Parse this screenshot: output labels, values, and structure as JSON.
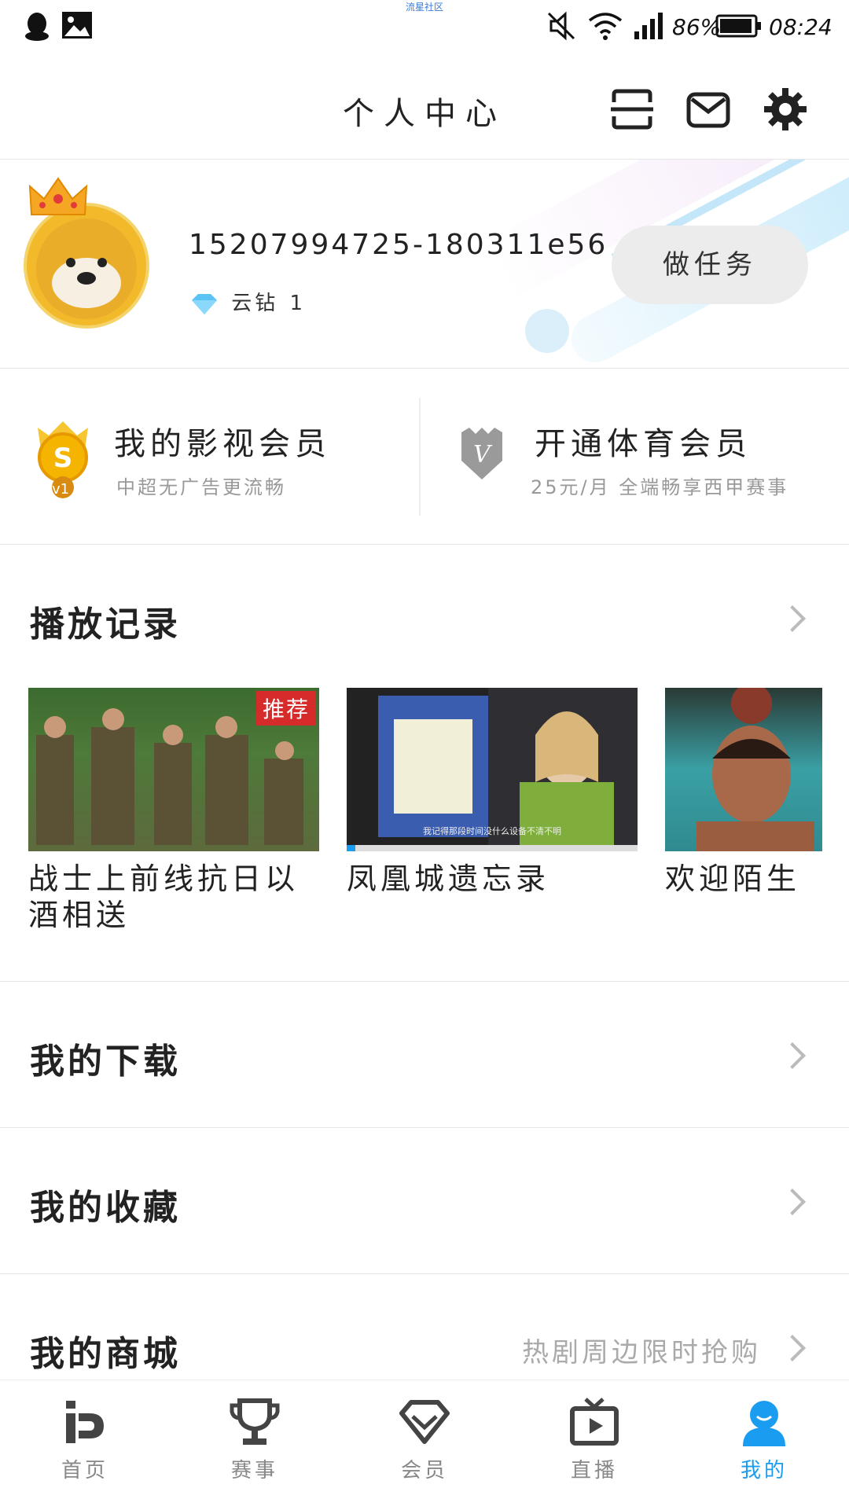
{
  "status_bar": {
    "watermark": "流星社区",
    "battery": "86%",
    "time": "08:24"
  },
  "header": {
    "title": "个人中心"
  },
  "profile": {
    "user_id": "15207994725-180311e56",
    "diamond_label": "云钻",
    "diamond_count": "1",
    "task_button": "做任务"
  },
  "members": {
    "video": {
      "title": "我的影视会员",
      "subtitle": "中超无广告更流畅",
      "level_badge": "v1"
    },
    "sports": {
      "title": "开通体育会员",
      "subtitle": "25元/月 全端畅享西甲赛事",
      "badge_letter": "V"
    }
  },
  "history": {
    "title": "播放记录",
    "items": [
      {
        "title": "战士上前线抗日以酒相送",
        "tag": "推荐",
        "progress": 0
      },
      {
        "title": "凤凰城遗忘录",
        "tag": "",
        "progress": 0.03
      },
      {
        "title": "欢迎陌生",
        "tag": "",
        "progress": 0
      }
    ],
    "subtitle_text": "我记得那段时间没什么设备不清不明"
  },
  "rows": {
    "downloads": {
      "title": "我的下载"
    },
    "favorites": {
      "title": "我的收藏"
    },
    "mall": {
      "title": "我的商城",
      "subtitle": "热剧周边限时抢购"
    }
  },
  "nav": [
    {
      "label": "首页",
      "icon": "home-pp-icon"
    },
    {
      "label": "赛事",
      "icon": "trophy-icon"
    },
    {
      "label": "会员",
      "icon": "diamond-icon"
    },
    {
      "label": "直播",
      "icon": "tv-play-icon"
    },
    {
      "label": "我的",
      "icon": "person-icon",
      "active": true
    }
  ],
  "colors": {
    "accent": "#1a9cf0",
    "tag_red": "#d62b2b",
    "avatar_yellow": "#f2b92b"
  }
}
